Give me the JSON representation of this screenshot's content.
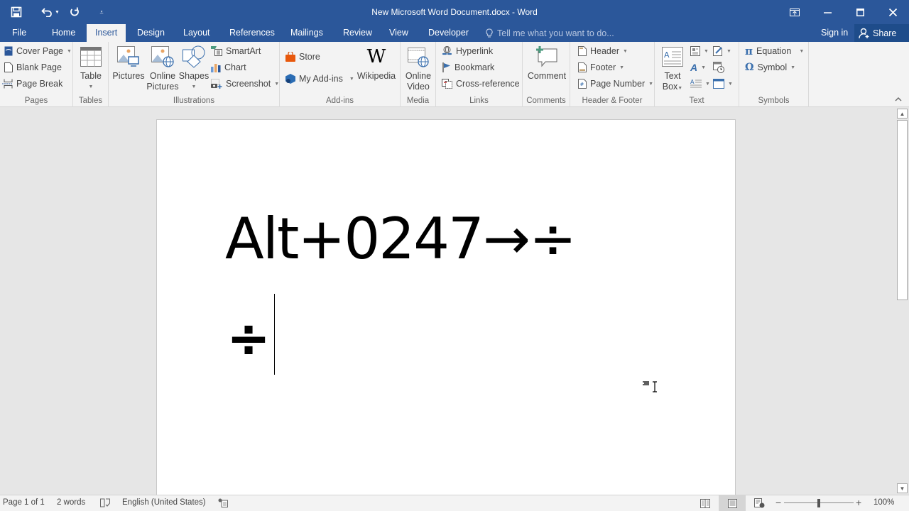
{
  "window": {
    "title": "New Microsoft Word Document.docx - Word",
    "brand_color": "#2b579a"
  },
  "qat": {
    "save_icon": "save-icon",
    "undo_icon": "undo-icon",
    "redo_icon": "redo-icon",
    "customize_icon": "customize-qat-icon"
  },
  "tabs": [
    {
      "label": "File"
    },
    {
      "label": "Home"
    },
    {
      "label": "Insert",
      "active": true
    },
    {
      "label": "Design"
    },
    {
      "label": "Layout"
    },
    {
      "label": "References"
    },
    {
      "label": "Mailings"
    },
    {
      "label": "Review"
    },
    {
      "label": "View"
    },
    {
      "label": "Developer"
    }
  ],
  "tellme": {
    "placeholder": "Tell me what you want to do..."
  },
  "account": {
    "signin": "Sign in",
    "share": "Share"
  },
  "ribbon": {
    "pages": {
      "label": "Pages",
      "cover_page": "Cover Page",
      "blank_page": "Blank Page",
      "page_break": "Page Break"
    },
    "tables": {
      "label": "Tables",
      "table": "Table"
    },
    "illustrations": {
      "label": "Illustrations",
      "pictures": "Pictures",
      "online_pictures_1": "Online",
      "online_pictures_2": "Pictures",
      "shapes": "Shapes",
      "smartart": "SmartArt",
      "chart": "Chart",
      "screenshot": "Screenshot"
    },
    "addins": {
      "label": "Add-ins",
      "store": "Store",
      "my_addins": "My Add-ins",
      "wikipedia": "Wikipedia"
    },
    "media": {
      "label": "Media",
      "online_video_1": "Online",
      "online_video_2": "Video"
    },
    "links": {
      "label": "Links",
      "hyperlink": "Hyperlink",
      "bookmark": "Bookmark",
      "cross_reference": "Cross-reference"
    },
    "comments": {
      "label": "Comments",
      "comment": "Comment"
    },
    "header_footer": {
      "label": "Header & Footer",
      "header": "Header",
      "footer": "Footer",
      "page_number": "Page Number"
    },
    "text": {
      "label": "Text",
      "text_box_1": "Text",
      "text_box_2": "Box"
    },
    "symbols": {
      "label": "Symbols",
      "equation": "Equation",
      "symbol": "Symbol"
    }
  },
  "document": {
    "line1": "Alt+0247→÷",
    "line2": "÷"
  },
  "status": {
    "page": "Page 1 of 1",
    "words": "2 words",
    "language": "English (United States)",
    "zoom": "100%",
    "zoom_level_percent": 100
  }
}
